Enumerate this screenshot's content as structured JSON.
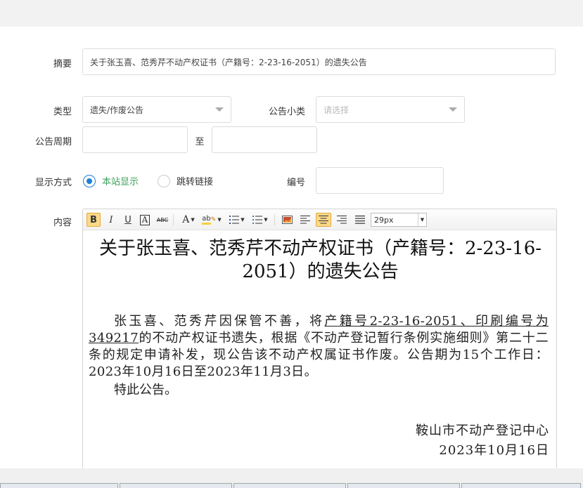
{
  "form": {
    "summary_label": "摘要",
    "summary_value": "关于张玉喜、范秀芹不动产权证书（产籍号：2-23-16-2051）的遗失公告",
    "type_label": "类型",
    "type_value": "遗失/作废公告",
    "subtype_label": "公告小类",
    "subtype_placeholder": "请选择",
    "period_label": "公告周期",
    "period_to": "至",
    "period_start": "",
    "period_end": "",
    "display_label": "显示方式",
    "display_option_site": "本站显示",
    "display_option_jump": "跳转链接",
    "display_selected": "本站显示",
    "number_label": "编号",
    "number_value": "",
    "content_label": "内容"
  },
  "toolbar": {
    "bold": "B",
    "italic": "I",
    "underline": "U",
    "font_color": "A",
    "strike": "ABC",
    "forecolor": "A",
    "highlight": "ab",
    "font_size_value": "29px"
  },
  "document": {
    "title": "关于张玉喜、范秀芹不动产权证书（产籍号：2-23-16-2051）的遗失公告",
    "para_before": "张玉喜、范秀芹因保管不善，将",
    "para_underlined": "产籍号2-23-16-2051、印刷编号为349217",
    "para_after": "的不动产权证书遗失，根据《不动产登记暂行条例实施细则》第二十二条的规定申请补发，现公告该不动产权属证书作废。公告期为15个工作日：2023年10月16日至2023年11月3日。",
    "closing": "特此公告。",
    "signer": "鞍山市不动产登记中心",
    "date": "2023年10月16日"
  },
  "colors": {
    "accent": "#1e7fd8",
    "selected_label": "#3aa15a",
    "toolbar_active": "#fbd989"
  }
}
